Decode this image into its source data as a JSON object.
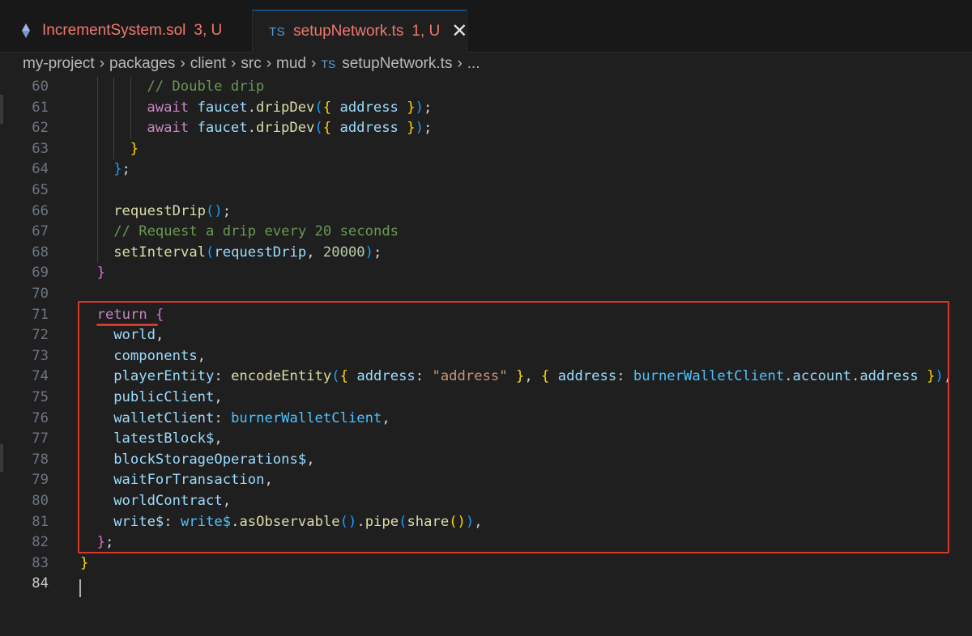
{
  "tabs": [
    {
      "name": "IncrementSystem.sol",
      "status": "3, U",
      "icon": "solidity-icon",
      "active": false
    },
    {
      "name": "setupNetwork.ts",
      "status": "1, U",
      "icon_text": "TS",
      "active": true
    }
  ],
  "breadcrumb": {
    "items": [
      "my-project",
      "packages",
      "client",
      "src",
      "mud"
    ],
    "file_icon": "TS",
    "file": "setupNetwork.ts",
    "more": "..."
  },
  "colors": {
    "highlight": "#d9382c",
    "keyword": "#c586c0",
    "variable": "#9cdcfe",
    "comment": "#6a9955",
    "function": "#dcdcaa"
  },
  "editor": {
    "active_line": "84",
    "lines": [
      {
        "num": "60",
        "tokens": [
          [
            "c",
            "// Double drip"
          ]
        ]
      },
      {
        "num": "61",
        "tokens": [
          [
            "k",
            "await"
          ],
          [
            "p",
            " "
          ],
          [
            "v",
            "faucet"
          ],
          [
            "p",
            "."
          ],
          [
            "f",
            "dripDev"
          ],
          [
            "b3",
            "("
          ],
          [
            "b1",
            "{"
          ],
          [
            "p",
            " "
          ],
          [
            "v",
            "address"
          ],
          [
            "p",
            " "
          ],
          [
            "b1",
            "}"
          ],
          [
            "b3",
            ")"
          ],
          [
            "p",
            ";"
          ]
        ]
      },
      {
        "num": "62",
        "tokens": [
          [
            "k",
            "await"
          ],
          [
            "p",
            " "
          ],
          [
            "v",
            "faucet"
          ],
          [
            "p",
            "."
          ],
          [
            "f",
            "dripDev"
          ],
          [
            "b3",
            "("
          ],
          [
            "b1",
            "{"
          ],
          [
            "p",
            " "
          ],
          [
            "v",
            "address"
          ],
          [
            "p",
            " "
          ],
          [
            "b1",
            "}"
          ],
          [
            "b3",
            ")"
          ],
          [
            "p",
            ";"
          ]
        ]
      },
      {
        "num": "63",
        "tokens": [
          [
            "b1",
            "}"
          ]
        ]
      },
      {
        "num": "64",
        "tokens": [
          [
            "b3",
            "}"
          ],
          [
            "p",
            ";"
          ]
        ]
      },
      {
        "num": "65",
        "tokens": []
      },
      {
        "num": "66",
        "tokens": [
          [
            "f",
            "requestDrip"
          ],
          [
            "b3",
            "()"
          ],
          [
            "p",
            ";"
          ]
        ]
      },
      {
        "num": "67",
        "tokens": [
          [
            "c",
            "// Request a drip every 20 seconds"
          ]
        ]
      },
      {
        "num": "68",
        "tokens": [
          [
            "f",
            "setInterval"
          ],
          [
            "b3",
            "("
          ],
          [
            "v",
            "requestDrip"
          ],
          [
            "p",
            ", "
          ],
          [
            "n",
            "20000"
          ],
          [
            "b3",
            ")"
          ],
          [
            "p",
            ";"
          ]
        ]
      },
      {
        "num": "69",
        "tokens": [
          [
            "b2",
            "}"
          ]
        ]
      },
      {
        "num": "70",
        "tokens": []
      },
      {
        "num": "71",
        "tokens": [
          [
            "k",
            "return"
          ],
          [
            "p",
            " "
          ],
          [
            "b2",
            "{"
          ]
        ]
      },
      {
        "num": "72",
        "tokens": [
          [
            "v",
            "world"
          ],
          [
            "p",
            ","
          ]
        ]
      },
      {
        "num": "73",
        "tokens": [
          [
            "v",
            "components"
          ],
          [
            "p",
            ","
          ]
        ]
      },
      {
        "num": "74",
        "tokens": [
          [
            "v",
            "playerEntity"
          ],
          [
            "p",
            ": "
          ],
          [
            "f",
            "encodeEntity"
          ],
          [
            "b3",
            "("
          ],
          [
            "b1",
            "{"
          ],
          [
            "p",
            " "
          ],
          [
            "v",
            "address"
          ],
          [
            "p",
            ": "
          ],
          [
            "s",
            "\"address\""
          ],
          [
            "p",
            " "
          ],
          [
            "b1",
            "}"
          ],
          [
            "p",
            ", "
          ],
          [
            "b1",
            "{"
          ],
          [
            "p",
            " "
          ],
          [
            "v",
            "address"
          ],
          [
            "p",
            ": "
          ],
          [
            "cst",
            "burnerWalletClient"
          ],
          [
            "p",
            "."
          ],
          [
            "v",
            "account"
          ],
          [
            "p",
            "."
          ],
          [
            "v",
            "address"
          ],
          [
            "p",
            " "
          ],
          [
            "b1",
            "}"
          ],
          [
            "b3",
            ")"
          ],
          [
            "p",
            ","
          ]
        ]
      },
      {
        "num": "75",
        "tokens": [
          [
            "v",
            "publicClient"
          ],
          [
            "p",
            ","
          ]
        ]
      },
      {
        "num": "76",
        "tokens": [
          [
            "v",
            "walletClient"
          ],
          [
            "p",
            ": "
          ],
          [
            "cst",
            "burnerWalletClient"
          ],
          [
            "p",
            ","
          ]
        ]
      },
      {
        "num": "77",
        "tokens": [
          [
            "v",
            "latestBlock$"
          ],
          [
            "p",
            ","
          ]
        ]
      },
      {
        "num": "78",
        "tokens": [
          [
            "v",
            "blockStorageOperations$"
          ],
          [
            "p",
            ","
          ]
        ]
      },
      {
        "num": "79",
        "tokens": [
          [
            "v",
            "waitForTransaction"
          ],
          [
            "p",
            ","
          ]
        ]
      },
      {
        "num": "80",
        "tokens": [
          [
            "v",
            "worldContract"
          ],
          [
            "p",
            ","
          ]
        ]
      },
      {
        "num": "81",
        "tokens": [
          [
            "v",
            "write$"
          ],
          [
            "p",
            ": "
          ],
          [
            "cst",
            "write$"
          ],
          [
            "p",
            "."
          ],
          [
            "f",
            "asObservable"
          ],
          [
            "b3",
            "()"
          ],
          [
            "p",
            "."
          ],
          [
            "f",
            "pipe"
          ],
          [
            "b3",
            "("
          ],
          [
            "f",
            "share"
          ],
          [
            "b1",
            "()"
          ],
          [
            "b3",
            ")"
          ],
          [
            "p",
            ","
          ]
        ]
      },
      {
        "num": "82",
        "tokens": [
          [
            "b2",
            "}"
          ],
          [
            "p",
            ";"
          ]
        ]
      },
      {
        "num": "83",
        "tokens": [
          [
            "b1",
            "}"
          ]
        ]
      },
      {
        "num": "84",
        "tokens": []
      }
    ]
  }
}
